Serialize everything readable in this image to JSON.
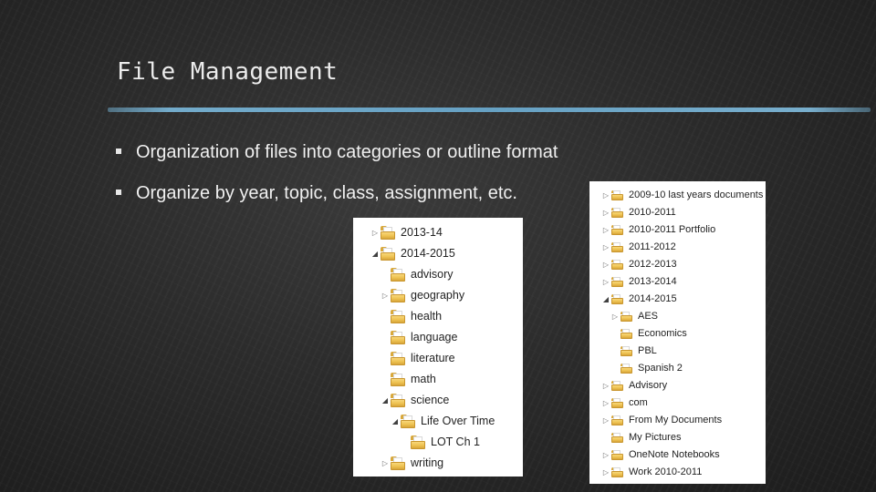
{
  "slide": {
    "title": "File Management",
    "bullets": [
      "Organization of files into categories or outline format",
      "Organize by year, topic, class, assignment, etc."
    ]
  },
  "tree_left": [
    {
      "label": "2013-14",
      "depth": 0,
      "state": "collapsed"
    },
    {
      "label": "2014-2015",
      "depth": 0,
      "state": "expanded"
    },
    {
      "label": "advisory",
      "depth": 1,
      "state": "none"
    },
    {
      "label": "geography",
      "depth": 1,
      "state": "collapsed"
    },
    {
      "label": "health",
      "depth": 1,
      "state": "none"
    },
    {
      "label": "language",
      "depth": 1,
      "state": "none"
    },
    {
      "label": "literature",
      "depth": 1,
      "state": "none"
    },
    {
      "label": "math",
      "depth": 1,
      "state": "none"
    },
    {
      "label": "science",
      "depth": 1,
      "state": "expanded"
    },
    {
      "label": "Life Over Time",
      "depth": 2,
      "state": "expanded"
    },
    {
      "label": "LOT Ch 1",
      "depth": 3,
      "state": "none"
    },
    {
      "label": "writing",
      "depth": 1,
      "state": "collapsed"
    }
  ],
  "tree_right": [
    {
      "label": "2009-10 last years documents",
      "depth": 0,
      "state": "collapsed"
    },
    {
      "label": "2010-2011",
      "depth": 0,
      "state": "collapsed"
    },
    {
      "label": "2010-2011 Portfolio",
      "depth": 0,
      "state": "collapsed"
    },
    {
      "label": "2011-2012",
      "depth": 0,
      "state": "collapsed"
    },
    {
      "label": "2012-2013",
      "depth": 0,
      "state": "collapsed"
    },
    {
      "label": "2013-2014",
      "depth": 0,
      "state": "collapsed"
    },
    {
      "label": "2014-2015",
      "depth": 0,
      "state": "expanded"
    },
    {
      "label": "AES",
      "depth": 1,
      "state": "collapsed"
    },
    {
      "label": "Economics",
      "depth": 1,
      "state": "none"
    },
    {
      "label": "PBL",
      "depth": 1,
      "state": "none"
    },
    {
      "label": "Spanish 2",
      "depth": 1,
      "state": "none"
    },
    {
      "label": "Advisory",
      "depth": 0,
      "state": "collapsed"
    },
    {
      "label": "com",
      "depth": 0,
      "state": "collapsed"
    },
    {
      "label": "From My Documents",
      "depth": 0,
      "state": "collapsed"
    },
    {
      "label": "My Pictures",
      "depth": 0,
      "state": "none"
    },
    {
      "label": "OneNote Notebooks",
      "depth": 0,
      "state": "collapsed"
    },
    {
      "label": "Work 2010-2011",
      "depth": 0,
      "state": "collapsed"
    }
  ],
  "colors": {
    "rule": "#7fc1e6",
    "folder": "#eec251",
    "background": "#2b2b2b"
  }
}
